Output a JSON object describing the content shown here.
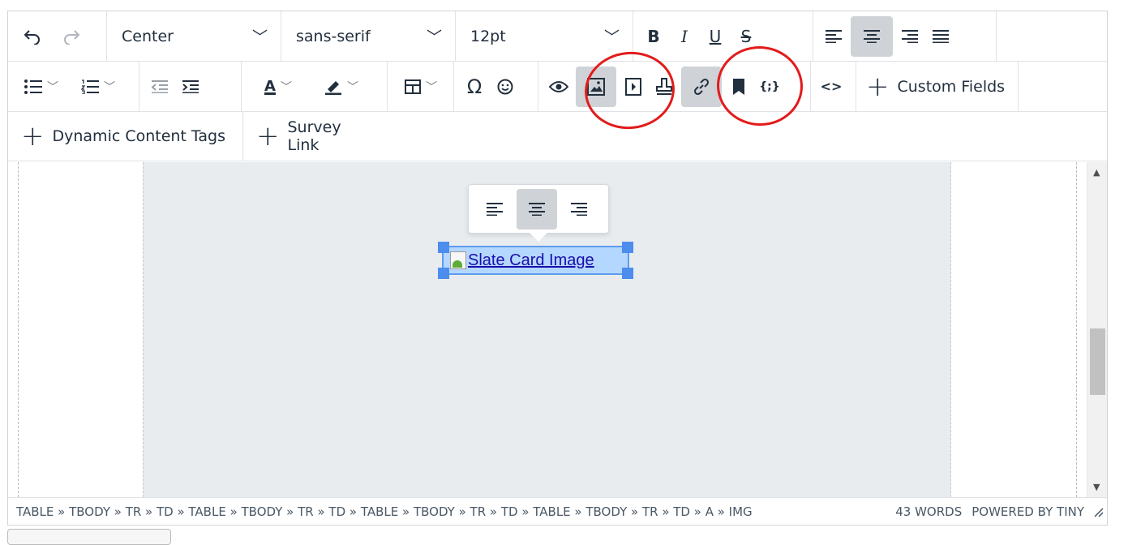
{
  "toolbar": {
    "row1": {
      "block_format": "Center",
      "font_family": "sans-serif",
      "font_size": "12pt",
      "bold_label": "B",
      "italic_label": "I",
      "underline_label": "U",
      "strikethrough_label": "S"
    },
    "row2": {
      "special_char_label": "Ω",
      "code_label": "{;}",
      "source_label": "<>",
      "custom_fields_label": "Custom Fields"
    },
    "row3": {
      "dynamic_tags_label": "Dynamic Content Tags",
      "survey_link_label": "Survey Link"
    }
  },
  "content": {
    "image_alt_text": "Slate Card Image"
  },
  "statusbar": {
    "element_path": "TABLE » TBODY » TR » TD » TABLE » TBODY » TR » TD » TABLE » TBODY » TR » TD » TABLE » TBODY » TR » TD » A » IMG",
    "word_count": "43 WORDS",
    "brand": "POWERED BY TINY"
  },
  "colors": {
    "active_button_bg": "#cfd3d7",
    "selection_bg": "#b4d7ff",
    "selection_handle": "#4c8dee",
    "annotation_circle": "#e31b1b"
  }
}
